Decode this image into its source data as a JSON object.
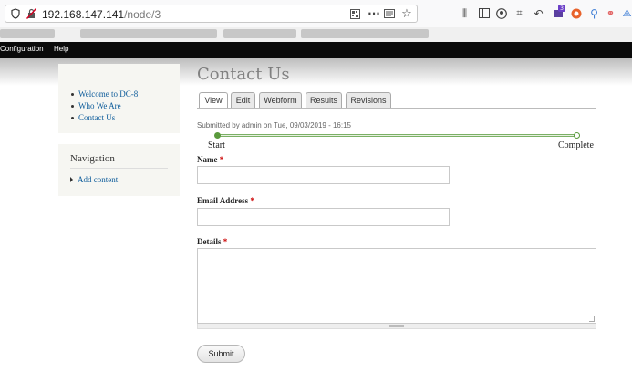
{
  "browser": {
    "url_host": "192.168.147.141",
    "url_path": "/node/3",
    "icons": [
      "shield-icon",
      "insecure-lock-icon",
      "qr-code-icon",
      "page-actions-icon",
      "reader-view-icon",
      "bookmark-star-icon"
    ],
    "toolbar_icons": [
      "library-icon",
      "sidebar-icon",
      "account-icon",
      "screenshot-icon",
      "back-arrow-icon",
      "extension-icon",
      "extension-icon-2",
      "location-icon",
      "link-icon",
      "lens-icon"
    ],
    "extension_badge": "3"
  },
  "admin_toolbar": {
    "items": [
      "Configuration",
      "Help"
    ]
  },
  "page": {
    "title": "Contact Us"
  },
  "sidebar": {
    "menu": [
      "Welcome to DC-8",
      "Who We Are",
      "Contact Us"
    ],
    "navigation": {
      "title": "Navigation",
      "items": [
        "Add content"
      ]
    }
  },
  "tabs": [
    "View",
    "Edit",
    "Webform",
    "Results",
    "Revisions"
  ],
  "submitted": "Submitted by admin on Tue, 09/03/2019 - 16:15",
  "progress": {
    "start_label": "Start",
    "end_label": "Complete",
    "value": 0
  },
  "form": {
    "name_label": "Name",
    "email_label": "Email Address",
    "details_label": "Details",
    "required_mark": "*",
    "submit_label": "Submit"
  },
  "colors": {
    "link": "#0c5b9a",
    "progress": "#5a9a3c",
    "required": "#cc0000",
    "toolbar": "#0a0a0a"
  }
}
